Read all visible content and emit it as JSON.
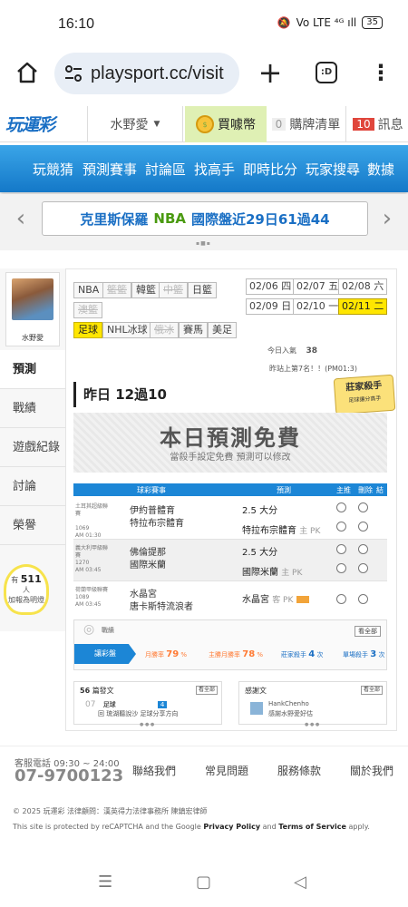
{
  "status": {
    "time": "16:10",
    "battery": "35",
    "signal": "Vo LTE ⁴ᴳ ıll"
  },
  "browser": {
    "url": "playsport.cc/visit",
    "tabs_label": ":D"
  },
  "site_header": {
    "logo": "玩運彩",
    "username": "水野愛",
    "coin_label": "買噱幣",
    "cart_count": "0",
    "cart_label": "購牌清單",
    "msg_count": "10",
    "msg_label": "訊息"
  },
  "nav": [
    "玩競猜",
    "預測賽事",
    "討論區",
    "找高手",
    "即時比分",
    "玩家搜尋",
    "數據"
  ],
  "ticker": {
    "part1": "克里斯保羅",
    "part2": "NBA",
    "part3": "國際盤近29日61過44"
  },
  "sidebar": {
    "username": "水野愛",
    "items": [
      "預測",
      "戰績",
      "遊戲紀錄",
      "討論",
      "榮譽"
    ],
    "bulb_pre": "有",
    "bulb_count": "511",
    "bulb_post": "人",
    "bulb_note": "加報為明燈"
  },
  "sports_row1": [
    "NBA",
    "籃籃",
    "韓籃",
    "中籃",
    "日籃",
    "澳籃"
  ],
  "sports_row2": [
    "足球",
    "NHL冰球",
    "俄冰",
    "賽馬",
    "美足"
  ],
  "dates": [
    "02/06 四",
    "02/07 五",
    "02/08 六",
    "02/09 日",
    "02/10 一",
    "02/11 二"
  ],
  "today": {
    "label": "今日入氣",
    "count": "38",
    "rank": "昨站上第7名！！(PM01:3)"
  },
  "summary": "昨日 12過10",
  "expert_badge": {
    "line1": "莊家殺手",
    "line2": "足球讓分高手"
  },
  "free_banner": {
    "title": "本日預測免費",
    "note": "當殺手設定免費 預測可以修改"
  },
  "table": {
    "headers": [
      "球彩賽事",
      "預測",
      "主推",
      "刪除",
      "結果"
    ],
    "rows": [
      {
        "league": "土耳其超級聯賽",
        "code": "1069",
        "time": "AM 01:30",
        "home": "伊約普體育",
        "away": "特拉布宗體育",
        "pick1": "2.5 大分",
        "pick2": "特拉布宗體育",
        "pick2_tag": "主 PK"
      },
      {
        "league": "義大利甲級聯賽",
        "code": "1270",
        "time": "AM 03:45",
        "home": "佛倫提那",
        "away": "國際米蘭",
        "pick1": "2.5 大分",
        "pick2": "國際米蘭",
        "pick2_tag": "主 PK"
      },
      {
        "league": "荷蘭甲級聯賽",
        "code": "1089",
        "time": "AM 03:45",
        "home": "水晶宮",
        "away": "唐卡斯特流浪者",
        "pick1": "",
        "pick2": "水晶宮",
        "pick2_tag": "客 PK"
      }
    ]
  },
  "stats": {
    "title": "戰績",
    "tab": "讓彩盤",
    "items": [
      {
        "label": "月勝率",
        "value": "79",
        "unit": "%"
      },
      {
        "label": "主勝月勝率",
        "value": "78",
        "unit": "%"
      },
      {
        "label": "莊家殺手",
        "value": "4",
        "unit": "次"
      },
      {
        "label": "單場殺手",
        "value": "3",
        "unit": "次"
      }
    ],
    "more": "看全部"
  },
  "articles": {
    "count": "56",
    "title": "篇發文",
    "date": "07",
    "tag": "足球",
    "line": "回 琉湖聽說沙 足球分享方向",
    "badge": "4",
    "more": "看全部"
  },
  "comments": {
    "title": "感謝文",
    "user": "HankChenho",
    "line": "感謝水野愛好估",
    "more": "看全部"
  },
  "footer": {
    "hotline_label": "客服電話 09:30 ~ 24:00",
    "hotline": "07-9700123",
    "links": [
      "聯絡我們",
      "常見問題",
      "服務條款",
      "關於我們"
    ],
    "copyright": "© 2025 玩運彩 法律顧問：漢英得力法律事務所 陳鎮宏律師",
    "recaptcha_pre": "This site is protected by reCAPTCHA and the Google",
    "privacy": "Privacy Policy",
    "and": "and",
    "terms": "Terms of Service",
    "apply": "apply."
  }
}
